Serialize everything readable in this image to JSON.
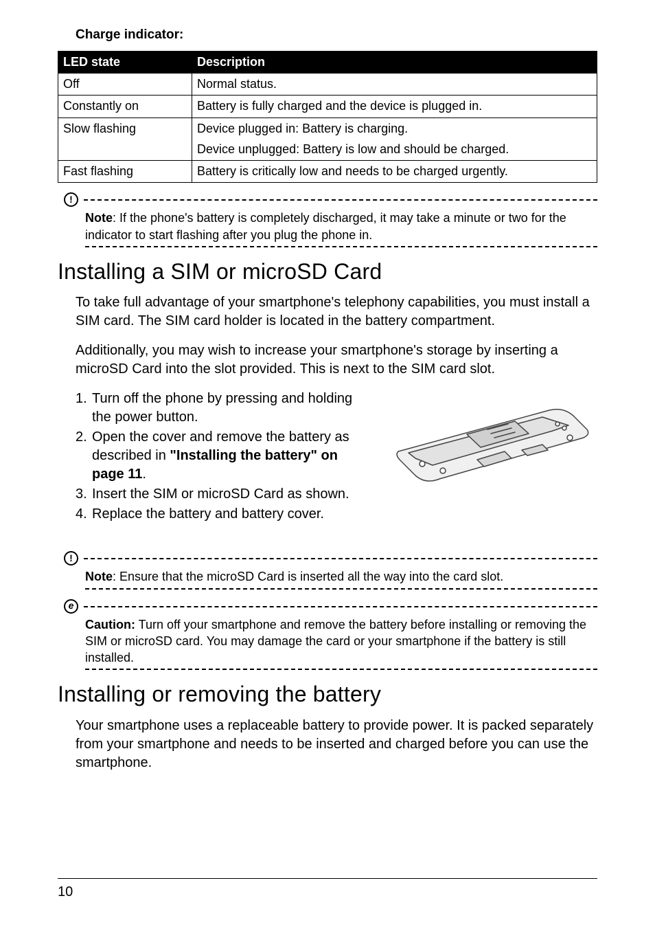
{
  "page_number": "10",
  "charge_indicator_heading": "Charge indicator:",
  "table": {
    "headers": [
      "LED state",
      "Description"
    ],
    "rows": [
      {
        "state": "Off",
        "desc": [
          "Normal status."
        ]
      },
      {
        "state": "Constantly on",
        "desc": [
          "Battery is fully charged and the device is plugged in."
        ]
      },
      {
        "state": "Slow flashing",
        "desc": [
          "Device plugged in: Battery is charging.",
          "Device unplugged: Battery is low and should be charged."
        ]
      },
      {
        "state": "Fast flashing",
        "desc": [
          "Battery is critically low and needs to be charged urgently."
        ]
      }
    ]
  },
  "note1": {
    "lead": "Note",
    "text": ": If the phone's battery is completely discharged, it may take a minute or two for the indicator to start flashing after you plug the phone in."
  },
  "section1": {
    "title": "Installing a SIM or microSD Card",
    "para1": "To take full advantage of your smartphone's telephony capabilities, you must install a SIM card. The SIM card holder is located in the battery compartment.",
    "para2": "Additionally, you may wish to increase your smartphone's storage by inserting a microSD Card into the slot provided. This is next to the SIM card slot.",
    "steps": {
      "s1": "Turn off the phone by pressing and holding the power button.",
      "s2a": "Open the cover and remove the battery as described in ",
      "s2ref": "\"Installing the battery\" on page 11",
      "s2b": ".",
      "s3": "Insert the SIM or microSD Card as shown.",
      "s4": "Replace the battery and battery cover."
    }
  },
  "note2": {
    "lead": "Note",
    "text": ": Ensure that the microSD Card is inserted all the way into the card slot."
  },
  "caution": {
    "lead": "Caution:",
    "text": " Turn off your smartphone and remove the battery before installing or removing the SIM or microSD card. You may damage the card or your smartphone if the battery is still installed."
  },
  "section2": {
    "title": "Installing or removing the battery",
    "para1": "Your smartphone uses a replaceable battery to provide power. It is packed separately from your smartphone and needs to be inserted and charged before you can use the smartphone."
  }
}
